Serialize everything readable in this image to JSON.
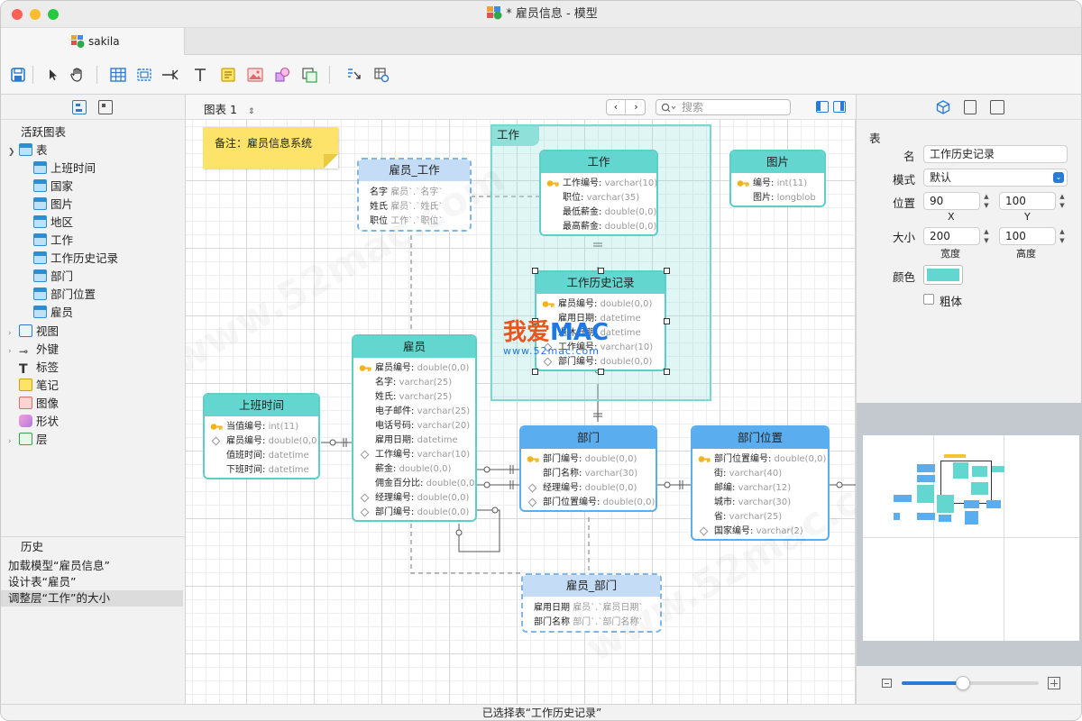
{
  "window": {
    "title": "* 雇员信息 - 模型",
    "tab": "sakila"
  },
  "colors": {
    "teal": "#5ccfc7",
    "teal_head": "#62d6cf",
    "blue": "#5aaef0",
    "view_head": "#c4dcf6",
    "group": "#dff5f3",
    "note": "#fde36a",
    "accent": "#2b7bd6"
  },
  "canvas_head": {
    "diagram": "图表 1",
    "search_placeholder": "搜索"
  },
  "tree": {
    "title": "活跃图表",
    "tables_label": "表",
    "tables": [
      "上班时间",
      "国家",
      "图片",
      "地区",
      "工作",
      "工作历史记录",
      "部门",
      "部门位置",
      "雇员"
    ],
    "others": [
      {
        "label": "视图",
        "icon": "view-icon"
      },
      {
        "label": "外键",
        "icon": "foreign-key-icon"
      },
      {
        "label": "标签",
        "icon": "text-label-icon"
      },
      {
        "label": "笔记",
        "icon": "note-icon"
      },
      {
        "label": "图像",
        "icon": "image-icon"
      },
      {
        "label": "形状",
        "icon": "shape-icon"
      },
      {
        "label": "层",
        "icon": "layer-icon"
      }
    ]
  },
  "history": {
    "title": "历史",
    "items": [
      "加载模型“雇员信息”",
      "设计表“雇员”",
      "调整层“工作”的大小"
    ]
  },
  "note": {
    "text": "备注：雇员信息系统"
  },
  "group": {
    "label": "工作"
  },
  "entities": {
    "shift": {
      "title": "上班时间",
      "rows": [
        {
          "name": "当值编号:",
          "type": "int(11)",
          "mark": "key"
        },
        {
          "name": "雇员编号:",
          "type": "double(0,0)",
          "mark": "fk"
        },
        {
          "name": "值班时间:",
          "type": "datetime",
          "mark": ""
        },
        {
          "name": "下班时间:",
          "type": "datetime",
          "mark": ""
        }
      ]
    },
    "employee": {
      "title": "雇员",
      "rows": [
        {
          "name": "雇员编号:",
          "type": "double(0,0)",
          "mark": "key"
        },
        {
          "name": "名字:",
          "type": "varchar(25)",
          "mark": ""
        },
        {
          "name": "姓氏:",
          "type": "varchar(25)",
          "mark": ""
        },
        {
          "name": "电子邮件:",
          "type": "varchar(25)",
          "mark": ""
        },
        {
          "name": "电话号码:",
          "type": "varchar(20)",
          "mark": ""
        },
        {
          "name": "雇用日期:",
          "type": "datetime",
          "mark": ""
        },
        {
          "name": "工作编号:",
          "type": "varchar(10)",
          "mark": "fk"
        },
        {
          "name": "薪金:",
          "type": "double(0,0)",
          "mark": ""
        },
        {
          "name": "佣金百分比:",
          "type": "double(0,0)",
          "mark": ""
        },
        {
          "name": "经理编号:",
          "type": "double(0,0)",
          "mark": "fk"
        },
        {
          "name": "部门编号:",
          "type": "double(0,0)",
          "mark": "fk"
        }
      ]
    },
    "job": {
      "title": "工作",
      "rows": [
        {
          "name": "工作编号:",
          "type": "varchar(10)",
          "mark": "key"
        },
        {
          "name": "职位:",
          "type": "varchar(35)",
          "mark": ""
        },
        {
          "name": "最低薪金:",
          "type": "double(0,0)",
          "mark": ""
        },
        {
          "name": "最高薪金:",
          "type": "double(0,0)",
          "mark": ""
        }
      ]
    },
    "job_history": {
      "title": "工作历史记录",
      "rows": [
        {
          "name": "雇员编号:",
          "type": "double(0,0)",
          "mark": "key"
        },
        {
          "name": "雇用日期:",
          "type": "datetime",
          "mark": ""
        },
        {
          "name": "退休日期:",
          "type": "datetime",
          "mark": ""
        },
        {
          "name": "工作编号:",
          "type": "varchar(10)",
          "mark": "fk"
        },
        {
          "name": "部门编号:",
          "type": "double(0,0)",
          "mark": "fk"
        }
      ]
    },
    "picture": {
      "title": "图片",
      "rows": [
        {
          "name": "编号:",
          "type": "int(11)",
          "mark": "key"
        },
        {
          "name": "图片:",
          "type": "longblob",
          "mark": ""
        }
      ]
    },
    "department": {
      "title": "部门",
      "rows": [
        {
          "name": "部门编号:",
          "type": "double(0,0)",
          "mark": "key"
        },
        {
          "name": "部门名称:",
          "type": "varchar(30)",
          "mark": ""
        },
        {
          "name": "经理编号:",
          "type": "double(0,0)",
          "mark": "fk"
        },
        {
          "name": "部门位置编号:",
          "type": "double(0,0)",
          "mark": "fk"
        }
      ]
    },
    "location": {
      "title": "部门位置",
      "rows": [
        {
          "name": "部门位置编号:",
          "type": "double(0,0)",
          "mark": "key"
        },
        {
          "name": "街:",
          "type": "varchar(40)",
          "mark": ""
        },
        {
          "name": "邮编:",
          "type": "varchar(12)",
          "mark": ""
        },
        {
          "name": "城市:",
          "type": "varchar(30)",
          "mark": ""
        },
        {
          "name": "省:",
          "type": "varchar(25)",
          "mark": ""
        },
        {
          "name": "国家编号:",
          "type": "varchar(2)",
          "mark": "fk"
        }
      ]
    }
  },
  "views": {
    "emp_job": {
      "title": "雇员_工作",
      "rows": [
        {
          "name": "名字",
          "type": "雇员`.`名字`"
        },
        {
          "name": "姓氏",
          "type": "雇员`.`姓氏`"
        },
        {
          "name": "职位",
          "type": "工作`.`职位`"
        }
      ]
    },
    "emp_dept": {
      "title": "雇员_部门",
      "rows": [
        {
          "name": "雇用日期",
          "type": "雇员`.`雇员日期`"
        },
        {
          "name": "部门名称",
          "type": "部门`.`部门名称`"
        }
      ]
    }
  },
  "inspector": {
    "section": "表",
    "name_label": "名",
    "name_value": "工作历史记录",
    "mode_label": "模式",
    "mode_value": "默认",
    "pos_label": "位置",
    "x": "90",
    "y": "100",
    "x_label": "X",
    "y_label": "Y",
    "size_label": "大小",
    "width": "200",
    "height": "100",
    "width_label": "宽度",
    "height_label": "高度",
    "color_label": "颜色",
    "bold_label": "粗体"
  },
  "zoom": {
    "level": 0.45
  },
  "watermark": {
    "brand1": "我爱",
    "brand2": "MAC",
    "site": "www.52mac.com",
    "diag": "www.52mac.com"
  },
  "status": "已选择表“工作历史记录”"
}
